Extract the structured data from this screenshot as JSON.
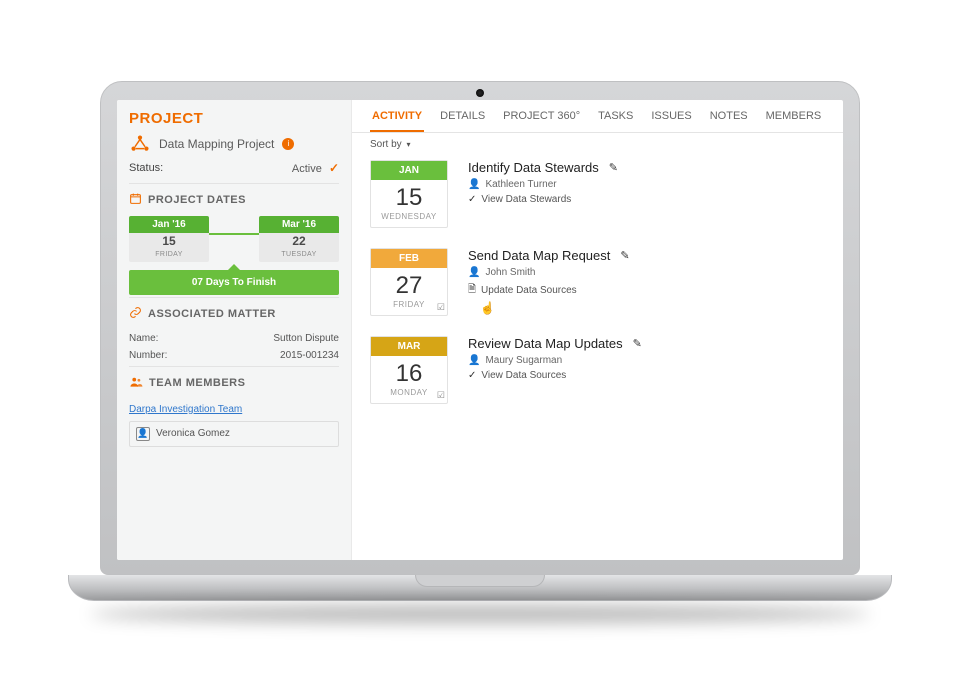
{
  "sidebar": {
    "label": "PROJECT",
    "title": "Data Mapping Project",
    "status_label": "Status:",
    "status_value": "Active",
    "info_icon_text": "i",
    "sections": {
      "dates": {
        "heading": "PROJECT DATES",
        "start": {
          "tag": "Jan '16",
          "day": "15",
          "weekday": "FRIDAY"
        },
        "end": {
          "tag": "Mar '16",
          "day": "22",
          "weekday": "TUESDAY"
        },
        "countdown": "07 Days To Finish"
      },
      "matter": {
        "heading": "ASSOCIATED MATTER",
        "name_label": "Name:",
        "name_value": "Sutton Dispute",
        "number_label": "Number:",
        "number_value": "2015-001234"
      },
      "team": {
        "heading": "TEAM MEMBERS",
        "team_link": "Darpa Investigation Team",
        "member": "Veronica Gomez"
      }
    }
  },
  "tabs": [
    {
      "label": "ACTIVITY",
      "active": true
    },
    {
      "label": "DETAILS",
      "active": false
    },
    {
      "label": "PROJECT 360°",
      "active": false
    },
    {
      "label": "TASKS",
      "active": false
    },
    {
      "label": "ISSUES",
      "active": false
    },
    {
      "label": "NOTES",
      "active": false
    },
    {
      "label": "MEMBERS",
      "active": false
    }
  ],
  "sort": {
    "label": "Sort by"
  },
  "feed": [
    {
      "month": "JAN",
      "month_color": "green",
      "day": "15",
      "weekday": "WEDNESDAY",
      "title": "Identify Data Stewards",
      "person": "Kathleen Turner",
      "sub_icon": "check",
      "sub": "View Data Stewards"
    },
    {
      "month": "FEB",
      "month_color": "orange",
      "day": "27",
      "weekday": "FRIDAY",
      "corner": "check",
      "title": "Send Data Map Request",
      "person": "John Smith",
      "sub_icon": "doc",
      "sub": "Update Data Sources",
      "cursor": true
    },
    {
      "month": "MAR",
      "month_color": "yellow",
      "day": "16",
      "weekday": "MONDAY",
      "corner": "check",
      "title": "Review Data Map Updates",
      "person": "Maury Sugarman",
      "sub_icon": "check",
      "sub": "View Data Sources"
    }
  ],
  "glyphs": {
    "pencil": "✎",
    "check": "✓",
    "person": "👤",
    "doc": "🗎",
    "caret": "▾",
    "hand": "☝"
  }
}
